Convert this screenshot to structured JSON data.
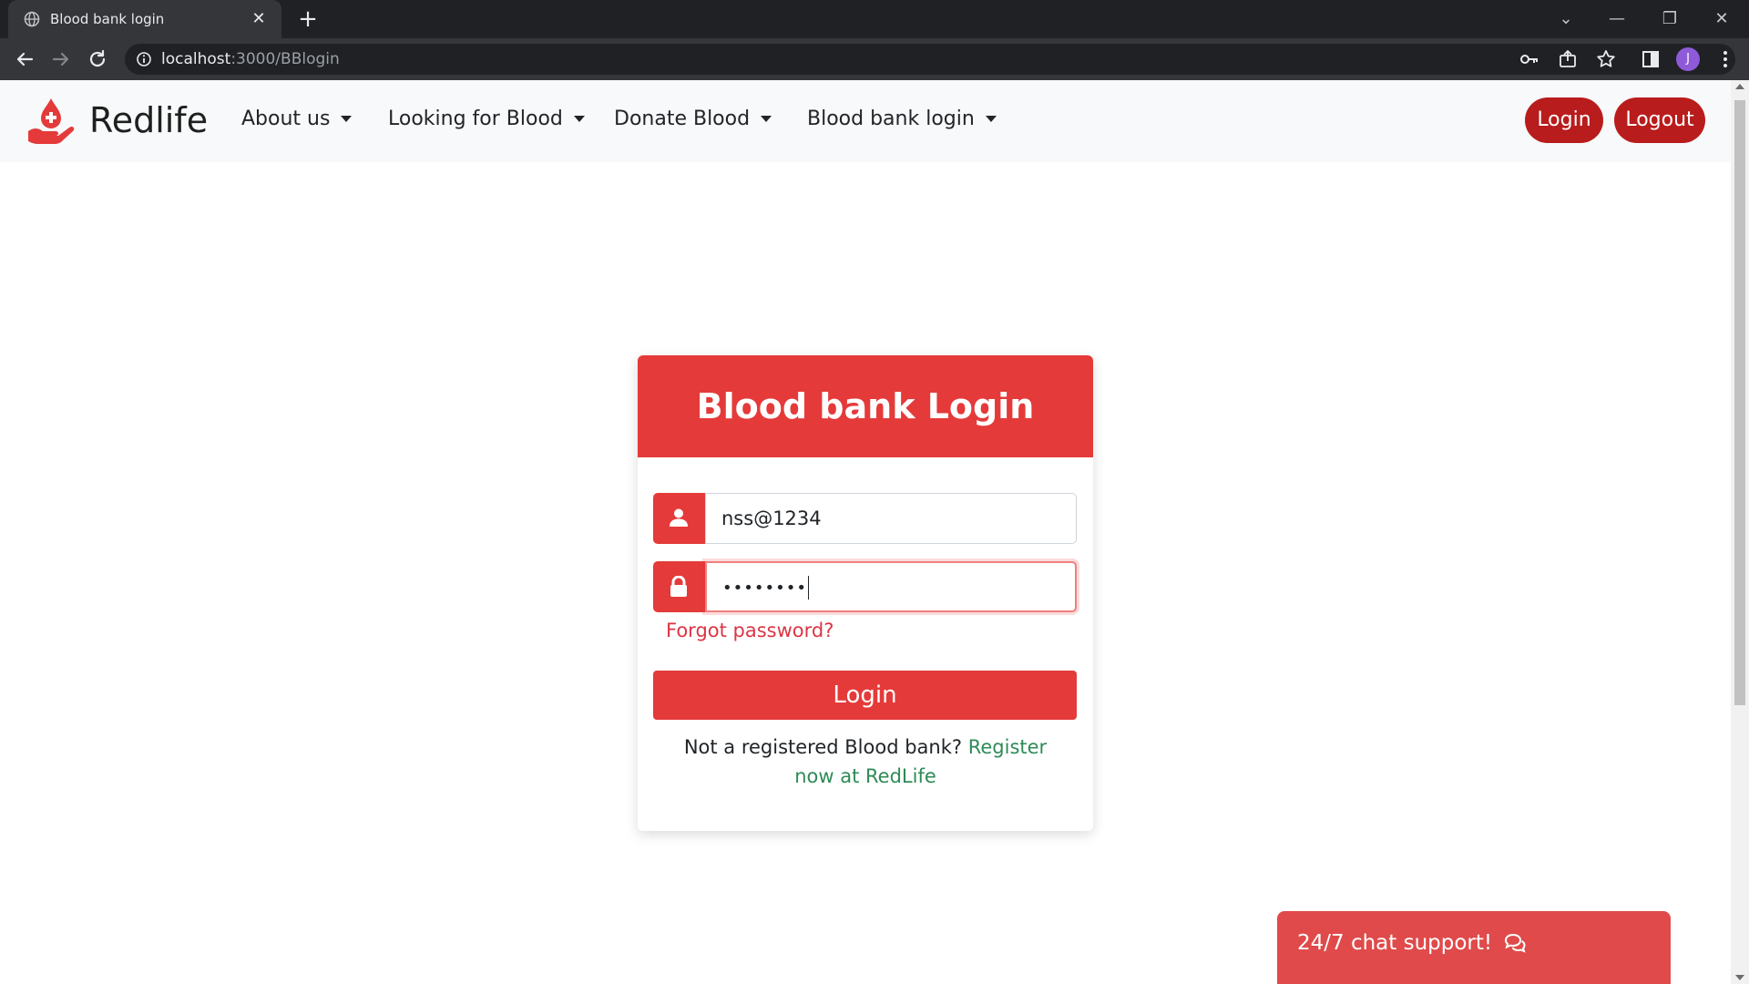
{
  "browser": {
    "tab_title": "Blood bank login",
    "tab_close_glyph": "✕",
    "new_tab_glyph": "+",
    "url_host": "localhost",
    "url_path": ":3000/BBlogin",
    "avatar_initial": "J",
    "window_controls": {
      "dropdown": "⌄",
      "minimize": "—",
      "restore": "❐",
      "close": "✕"
    }
  },
  "navbar": {
    "brand": "Redlife",
    "items": [
      {
        "label": "About us"
      },
      {
        "label": "Looking for Blood"
      },
      {
        "label": "Donate Blood"
      },
      {
        "label": "Blood bank login"
      }
    ],
    "login_label": "Login",
    "logout_label": "Logout"
  },
  "login_card": {
    "title": "Blood bank Login",
    "username_value": "nss@1234",
    "password_mask": "••••••••",
    "forgot_label": "Forgot password?",
    "submit_label": "Login",
    "register_prompt": "Not a registered Blood bank? ",
    "register_link": "Register now at RedLife"
  },
  "chat": {
    "label": "24/7 chat support!",
    "icon": "comments-icon"
  },
  "colors": {
    "brand_red": "#e53a3a",
    "nav_pill": "#b91c1c",
    "link_green": "#2e8b57",
    "chat_red": "#e04a4a"
  }
}
